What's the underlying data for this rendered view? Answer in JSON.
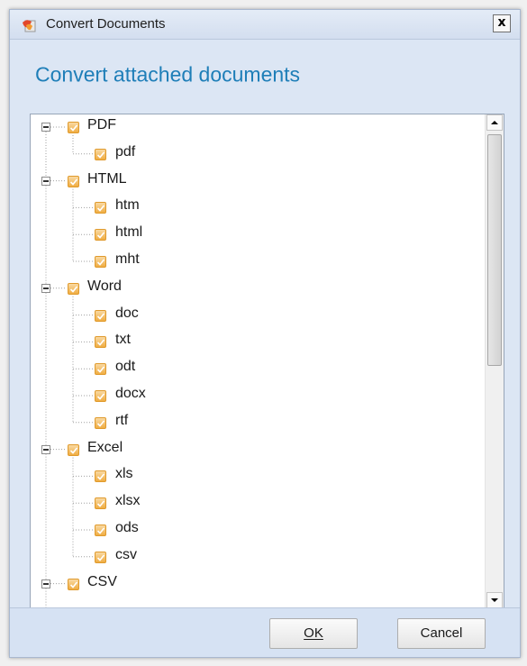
{
  "window": {
    "title": "Convert Documents",
    "close_label": "x"
  },
  "heading": "Convert attached documents",
  "tree": [
    {
      "label": "PDF",
      "checked": true,
      "children": [
        {
          "label": "pdf",
          "checked": true
        }
      ]
    },
    {
      "label": "HTML",
      "checked": true,
      "children": [
        {
          "label": "htm",
          "checked": true
        },
        {
          "label": "html",
          "checked": true
        },
        {
          "label": "mht",
          "checked": true
        }
      ]
    },
    {
      "label": "Word",
      "checked": true,
      "children": [
        {
          "label": "doc",
          "checked": true
        },
        {
          "label": "txt",
          "checked": true
        },
        {
          "label": "odt",
          "checked": true
        },
        {
          "label": "docx",
          "checked": true
        },
        {
          "label": "rtf",
          "checked": true
        }
      ]
    },
    {
      "label": "Excel",
      "checked": true,
      "children": [
        {
          "label": "xls",
          "checked": true
        },
        {
          "label": "xlsx",
          "checked": true
        },
        {
          "label": "ods",
          "checked": true
        },
        {
          "label": "csv",
          "checked": true
        }
      ]
    },
    {
      "label": "CSV",
      "checked": true,
      "children": []
    }
  ],
  "buttons": {
    "ok": "OK",
    "cancel": "Cancel"
  },
  "colors": {
    "heading": "#1e7eb8",
    "checkbox": "#f0ad43",
    "dialog_bg": "#dce6f4"
  },
  "icons": {
    "app": "convert-app-icon",
    "check": "check-icon",
    "expander": "collapse-minus-icon"
  }
}
